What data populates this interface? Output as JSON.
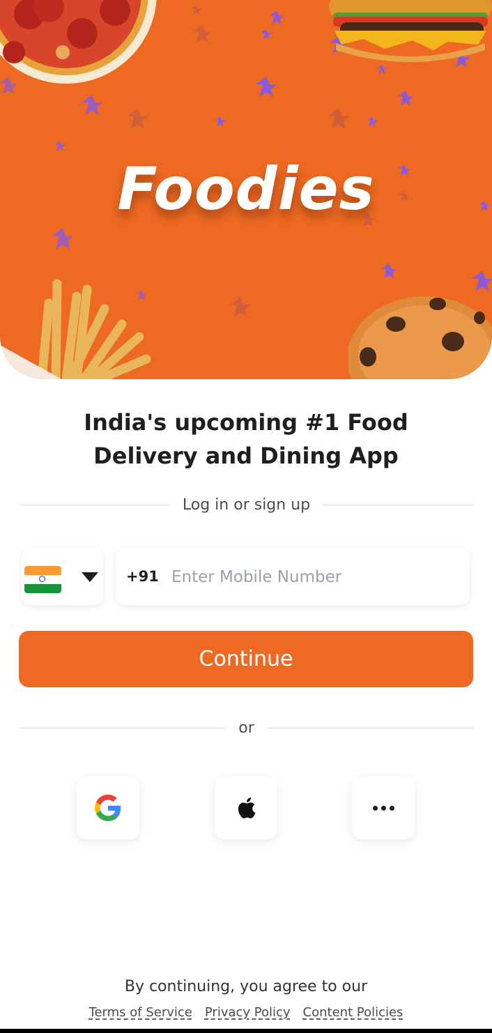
{
  "app": {
    "brand_name": "Foodies",
    "accent_color": "#ee6a22"
  },
  "banner": {
    "images": [
      "pizza",
      "burger",
      "french-fries",
      "chocolate-chip-muffin"
    ]
  },
  "headline": "India's upcoming #1 Food Delivery and Dining App",
  "login_divider": "Log in or sign up",
  "phone_form": {
    "country_flag": "india-flag-icon",
    "dial_code": "+91",
    "placeholder": "Enter Mobile Number",
    "value": ""
  },
  "continue_label": "Continue",
  "or_divider": "or",
  "social_logins": [
    {
      "name": "google",
      "icon": "google-icon"
    },
    {
      "name": "apple",
      "icon": "apple-icon"
    },
    {
      "name": "more",
      "icon": "more-options-icon"
    }
  ],
  "footer": {
    "agreement_text": "By continuing, you agree to our",
    "links": [
      "Terms of Service",
      "Privacy Policy",
      "Content Policies"
    ]
  }
}
